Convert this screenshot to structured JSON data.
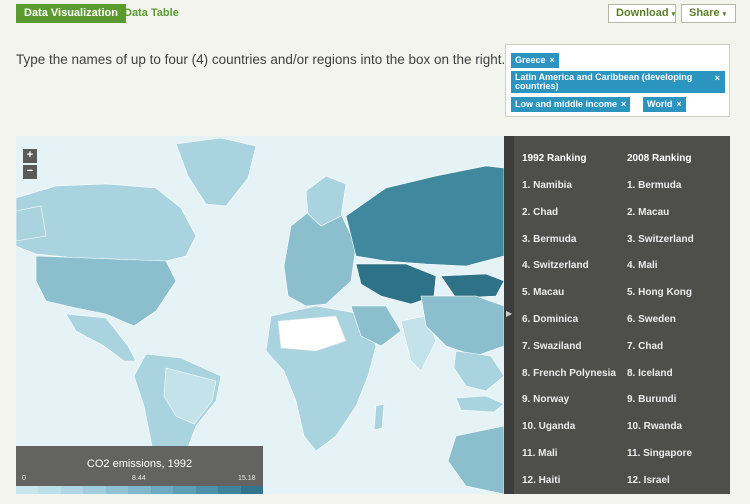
{
  "tabs": {
    "active": "Data Visualization",
    "other": "Data Table"
  },
  "buttons": {
    "download": "Download",
    "share": "Share",
    "caret": "▾"
  },
  "instruction": "Type the names of up to four (4) countries and/or regions into the box on the right.",
  "selected_countries": [
    "Greece",
    "Latin America and Caribbean (developing countries)",
    "Low and middle income",
    "World"
  ],
  "chip_remove": "×",
  "map": {
    "zoom_in": "+",
    "zoom_out": "−",
    "legend_title": "CO2 emissions, 1992",
    "legend_min": "0",
    "legend_mid": "8.44",
    "legend_max": "15.18",
    "legend_colors": [
      "#c9e5ee",
      "#bcdfea",
      "#aed6e4",
      "#a0cddd",
      "#90c2d5",
      "#80b7cc",
      "#6eaac2",
      "#5d9db6",
      "#4d8fa9",
      "#3e829c",
      "#33738d"
    ],
    "colors": {
      "ocean": "#e6f3f6",
      "land_light": "#a9d3df",
      "land_mid": "#8bbfce",
      "land_dark": "#3f889d",
      "land_darkest": "#2e7287",
      "land_none": "#ffffff"
    }
  },
  "rankings": {
    "header_1992": "1992 Ranking",
    "header_2008": "2008 Ranking",
    "list_1992": [
      "1. Namibia",
      "2. Chad",
      "3. Bermuda",
      "4. Switzerland",
      "5. Macau",
      "6. Dominica",
      "7. Swaziland",
      "8. French Polynesia",
      "9. Norway",
      "10. Uganda",
      "11. Mali",
      "12. Haiti"
    ],
    "list_2008": [
      "1. Bermuda",
      "2. Macau",
      "3. Switzerland",
      "4. Mali",
      "5. Hong Kong",
      "6. Sweden",
      "7. Chad",
      "8. Iceland",
      "9. Burundi",
      "10. Rwanda",
      "11. Singapore",
      "12. Israel"
    ]
  }
}
